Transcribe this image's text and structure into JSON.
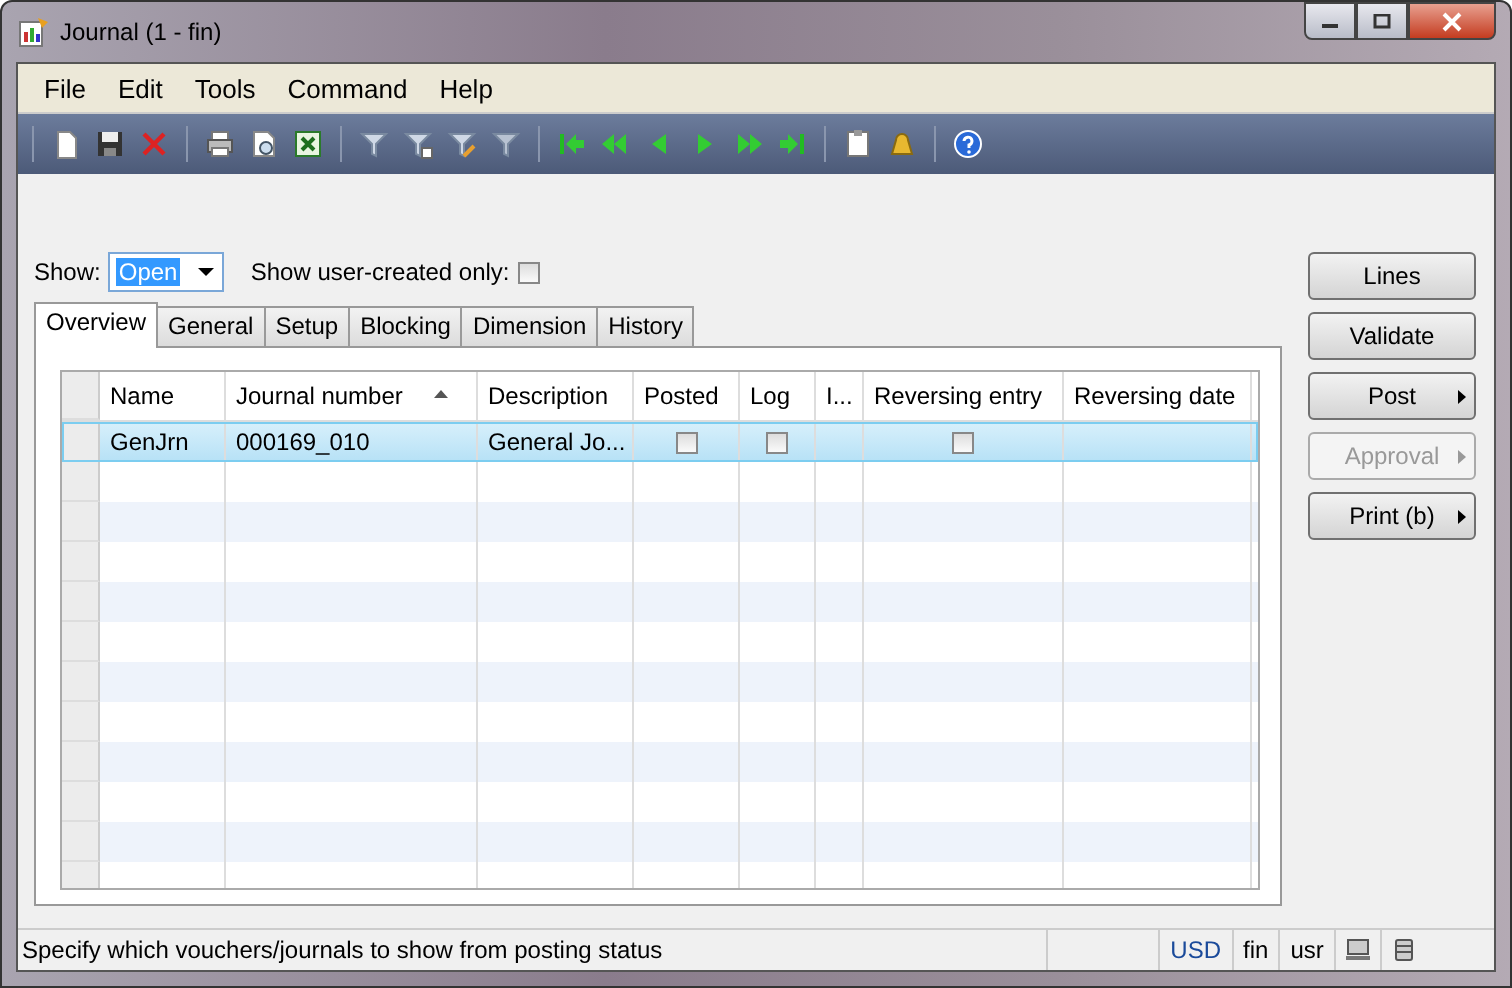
{
  "window": {
    "title": "Journal (1 - fin)"
  },
  "menu": [
    "File",
    "Edit",
    "Tools",
    "Command",
    "Help"
  ],
  "filter": {
    "label": "Show:",
    "value": "Open",
    "user_created_label": "Show user-created only:",
    "user_created_checked": false
  },
  "tabs": [
    {
      "label": "Overview",
      "selected": true
    },
    {
      "label": "General",
      "selected": false
    },
    {
      "label": "Setup",
      "selected": false
    },
    {
      "label": "Blocking",
      "selected": false
    },
    {
      "label": "Dimension",
      "selected": false
    },
    {
      "label": "History",
      "selected": false
    }
  ],
  "grid": {
    "columns": [
      {
        "label": "Name",
        "sorted": false
      },
      {
        "label": "Journal number",
        "sorted": true
      },
      {
        "label": "Description",
        "sorted": false
      },
      {
        "label": "Posted",
        "sorted": false
      },
      {
        "label": "Log",
        "sorted": false
      },
      {
        "label": "I...",
        "sorted": false
      },
      {
        "label": "Reversing entry",
        "sorted": false
      },
      {
        "label": "Reversing date",
        "sorted": false
      }
    ],
    "rows": [
      {
        "selected": true,
        "name": "GenJrn",
        "journal_number": "000169_010",
        "description": "General Jo...",
        "posted": false,
        "log": false,
        "reversing_entry": false
      }
    ]
  },
  "buttons": [
    {
      "label": "Lines",
      "menu": false,
      "disabled": false
    },
    {
      "label": "Validate",
      "menu": false,
      "disabled": false
    },
    {
      "label": "Post",
      "menu": true,
      "disabled": false
    },
    {
      "label": "Approval",
      "menu": true,
      "disabled": true
    },
    {
      "label": "Print (b)",
      "menu": true,
      "disabled": false
    }
  ],
  "status_bar": {
    "message": "Specify which vouchers/journals to show from posting status",
    "currency": "USD",
    "company": "fin",
    "user": "usr"
  }
}
